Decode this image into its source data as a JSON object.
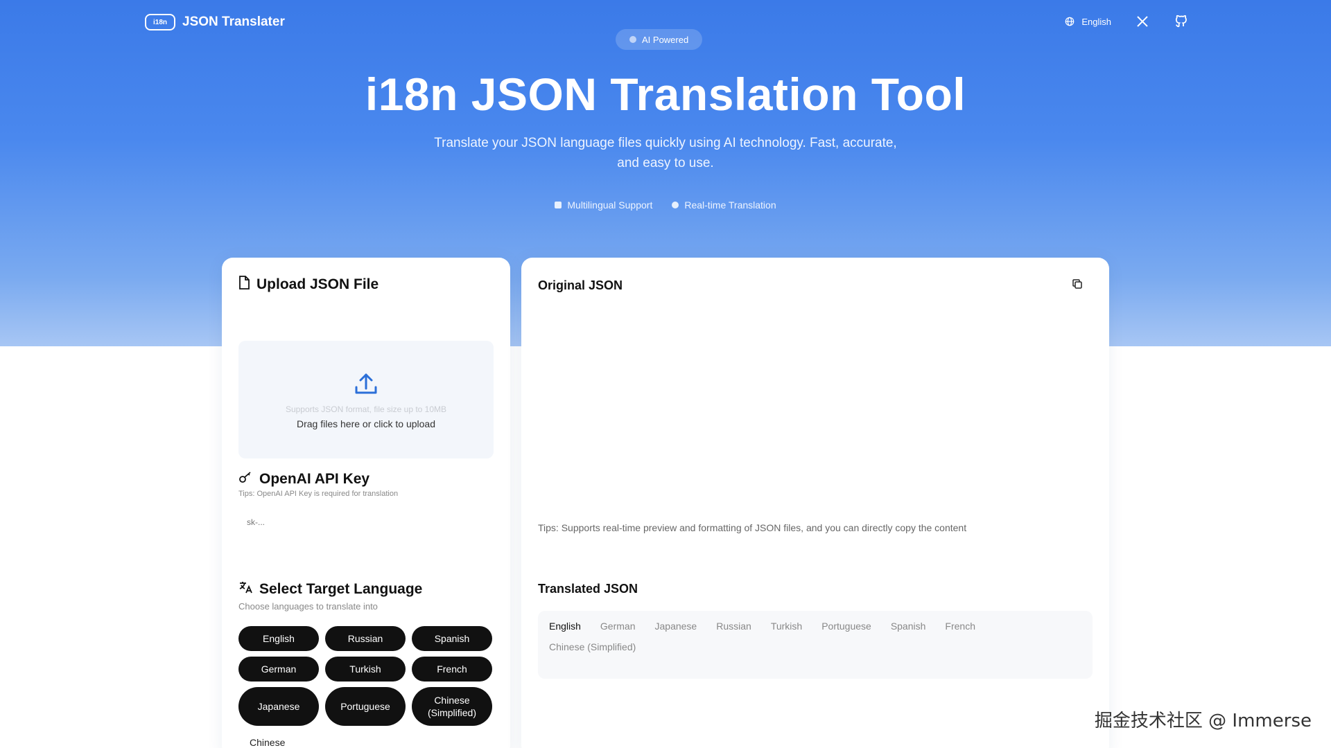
{
  "header": {
    "brand_logo": "i18n",
    "brand_name": "JSON Translater",
    "language": "English",
    "icons": [
      "globe-icon",
      "x-logo-icon",
      "github-icon"
    ]
  },
  "hero": {
    "badge": "AI Powered",
    "title": "i18n JSON Translation Tool",
    "subtitle": "Translate your JSON language files quickly using AI technology. Fast, accurate, and easy to use.",
    "features": [
      "Multilingual Support",
      "Real-time Translation"
    ]
  },
  "upload": {
    "title": "Upload JSON File",
    "hint": "Supports JSON format, file size up to 10MB",
    "text": "Drag files here or click to upload"
  },
  "api_key": {
    "title": "OpenAI API Key",
    "tip": "Tips: OpenAI API Key is required for translation",
    "placeholder": "sk-..."
  },
  "target_language": {
    "title": "Select Target Language",
    "subtitle": "Choose languages to translate into",
    "chips": [
      "English",
      "Russian",
      "Spanish",
      "German",
      "Turkish",
      "French",
      "Japanese",
      "Portuguese",
      "Chinese (Simplified)"
    ],
    "more": "Chinese"
  },
  "original": {
    "title": "Original JSON",
    "tips": "Tips: Supports real-time preview and formatting of JSON files, and you can directly copy the content"
  },
  "translated": {
    "title": "Translated JSON",
    "tabs": [
      "English",
      "German",
      "Japanese",
      "Russian",
      "Turkish",
      "Portuguese",
      "Spanish",
      "French",
      "Chinese (Simplified)"
    ]
  },
  "watermark": "掘金技术社区 @ Immerse",
  "colors": {
    "hero_top": "#3b7ae8",
    "hero_bottom": "#a7c6f4",
    "chip": "#111111"
  }
}
